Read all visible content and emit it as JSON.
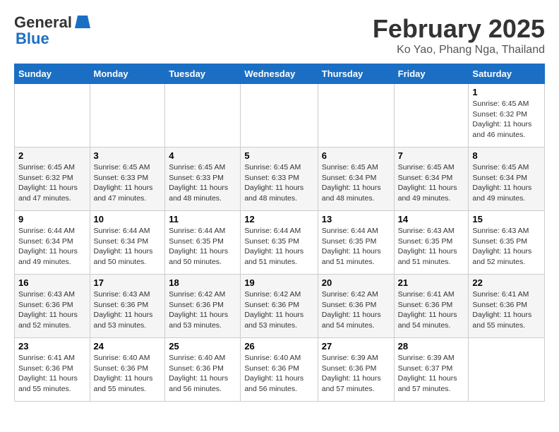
{
  "logo": {
    "line1": "General",
    "line2": "Blue"
  },
  "title": "February 2025",
  "subtitle": "Ko Yao, Phang Nga, Thailand",
  "days_of_week": [
    "Sunday",
    "Monday",
    "Tuesday",
    "Wednesday",
    "Thursday",
    "Friday",
    "Saturday"
  ],
  "weeks": [
    [
      {
        "day": "",
        "content": ""
      },
      {
        "day": "",
        "content": ""
      },
      {
        "day": "",
        "content": ""
      },
      {
        "day": "",
        "content": ""
      },
      {
        "day": "",
        "content": ""
      },
      {
        "day": "",
        "content": ""
      },
      {
        "day": "1",
        "content": "Sunrise: 6:45 AM\nSunset: 6:32 PM\nDaylight: 11 hours and 46 minutes."
      }
    ],
    [
      {
        "day": "2",
        "content": "Sunrise: 6:45 AM\nSunset: 6:32 PM\nDaylight: 11 hours and 47 minutes."
      },
      {
        "day": "3",
        "content": "Sunrise: 6:45 AM\nSunset: 6:33 PM\nDaylight: 11 hours and 47 minutes."
      },
      {
        "day": "4",
        "content": "Sunrise: 6:45 AM\nSunset: 6:33 PM\nDaylight: 11 hours and 48 minutes."
      },
      {
        "day": "5",
        "content": "Sunrise: 6:45 AM\nSunset: 6:33 PM\nDaylight: 11 hours and 48 minutes."
      },
      {
        "day": "6",
        "content": "Sunrise: 6:45 AM\nSunset: 6:34 PM\nDaylight: 11 hours and 48 minutes."
      },
      {
        "day": "7",
        "content": "Sunrise: 6:45 AM\nSunset: 6:34 PM\nDaylight: 11 hours and 49 minutes."
      },
      {
        "day": "8",
        "content": "Sunrise: 6:45 AM\nSunset: 6:34 PM\nDaylight: 11 hours and 49 minutes."
      }
    ],
    [
      {
        "day": "9",
        "content": "Sunrise: 6:44 AM\nSunset: 6:34 PM\nDaylight: 11 hours and 49 minutes."
      },
      {
        "day": "10",
        "content": "Sunrise: 6:44 AM\nSunset: 6:34 PM\nDaylight: 11 hours and 50 minutes."
      },
      {
        "day": "11",
        "content": "Sunrise: 6:44 AM\nSunset: 6:35 PM\nDaylight: 11 hours and 50 minutes."
      },
      {
        "day": "12",
        "content": "Sunrise: 6:44 AM\nSunset: 6:35 PM\nDaylight: 11 hours and 51 minutes."
      },
      {
        "day": "13",
        "content": "Sunrise: 6:44 AM\nSunset: 6:35 PM\nDaylight: 11 hours and 51 minutes."
      },
      {
        "day": "14",
        "content": "Sunrise: 6:43 AM\nSunset: 6:35 PM\nDaylight: 11 hours and 51 minutes."
      },
      {
        "day": "15",
        "content": "Sunrise: 6:43 AM\nSunset: 6:35 PM\nDaylight: 11 hours and 52 minutes."
      }
    ],
    [
      {
        "day": "16",
        "content": "Sunrise: 6:43 AM\nSunset: 6:36 PM\nDaylight: 11 hours and 52 minutes."
      },
      {
        "day": "17",
        "content": "Sunrise: 6:43 AM\nSunset: 6:36 PM\nDaylight: 11 hours and 53 minutes."
      },
      {
        "day": "18",
        "content": "Sunrise: 6:42 AM\nSunset: 6:36 PM\nDaylight: 11 hours and 53 minutes."
      },
      {
        "day": "19",
        "content": "Sunrise: 6:42 AM\nSunset: 6:36 PM\nDaylight: 11 hours and 53 minutes."
      },
      {
        "day": "20",
        "content": "Sunrise: 6:42 AM\nSunset: 6:36 PM\nDaylight: 11 hours and 54 minutes."
      },
      {
        "day": "21",
        "content": "Sunrise: 6:41 AM\nSunset: 6:36 PM\nDaylight: 11 hours and 54 minutes."
      },
      {
        "day": "22",
        "content": "Sunrise: 6:41 AM\nSunset: 6:36 PM\nDaylight: 11 hours and 55 minutes."
      }
    ],
    [
      {
        "day": "23",
        "content": "Sunrise: 6:41 AM\nSunset: 6:36 PM\nDaylight: 11 hours and 55 minutes."
      },
      {
        "day": "24",
        "content": "Sunrise: 6:40 AM\nSunset: 6:36 PM\nDaylight: 11 hours and 55 minutes."
      },
      {
        "day": "25",
        "content": "Sunrise: 6:40 AM\nSunset: 6:36 PM\nDaylight: 11 hours and 56 minutes."
      },
      {
        "day": "26",
        "content": "Sunrise: 6:40 AM\nSunset: 6:36 PM\nDaylight: 11 hours and 56 minutes."
      },
      {
        "day": "27",
        "content": "Sunrise: 6:39 AM\nSunset: 6:36 PM\nDaylight: 11 hours and 57 minutes."
      },
      {
        "day": "28",
        "content": "Sunrise: 6:39 AM\nSunset: 6:37 PM\nDaylight: 11 hours and 57 minutes."
      },
      {
        "day": "",
        "content": ""
      }
    ]
  ]
}
